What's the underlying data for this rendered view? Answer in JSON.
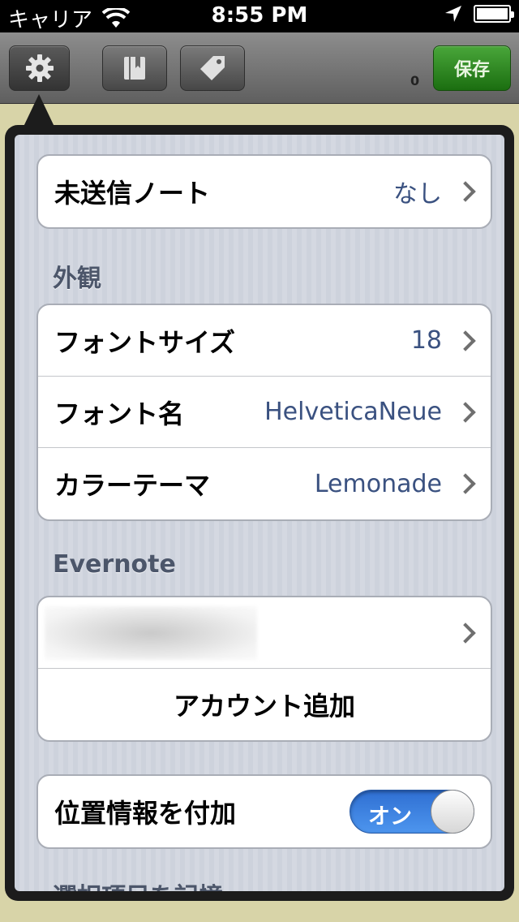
{
  "status_bar": {
    "carrier": "キャリア",
    "time": "8:55 PM"
  },
  "toolbar": {
    "save_label": "保存",
    "count": "0"
  },
  "settings": {
    "unsent_notes": {
      "label": "未送信ノート",
      "value": "なし"
    },
    "appearance_header": "外観",
    "font_size": {
      "label": "フォントサイズ",
      "value": "18"
    },
    "font_name": {
      "label": "フォント名",
      "value": "HelveticaNeue"
    },
    "color_theme": {
      "label": "カラーテーマ",
      "value": "Lemonade"
    },
    "evernote_header": "Evernote",
    "add_account_label": "アカウント追加",
    "location": {
      "label": "位置情報を付加",
      "toggle_text": "オン",
      "on": true
    },
    "next_header_cutoff": "選択項目を記憶"
  },
  "colors": {
    "save_button": "#2e8a22",
    "value_text": "#3a5180",
    "toggle_on": "#3a82e0"
  }
}
